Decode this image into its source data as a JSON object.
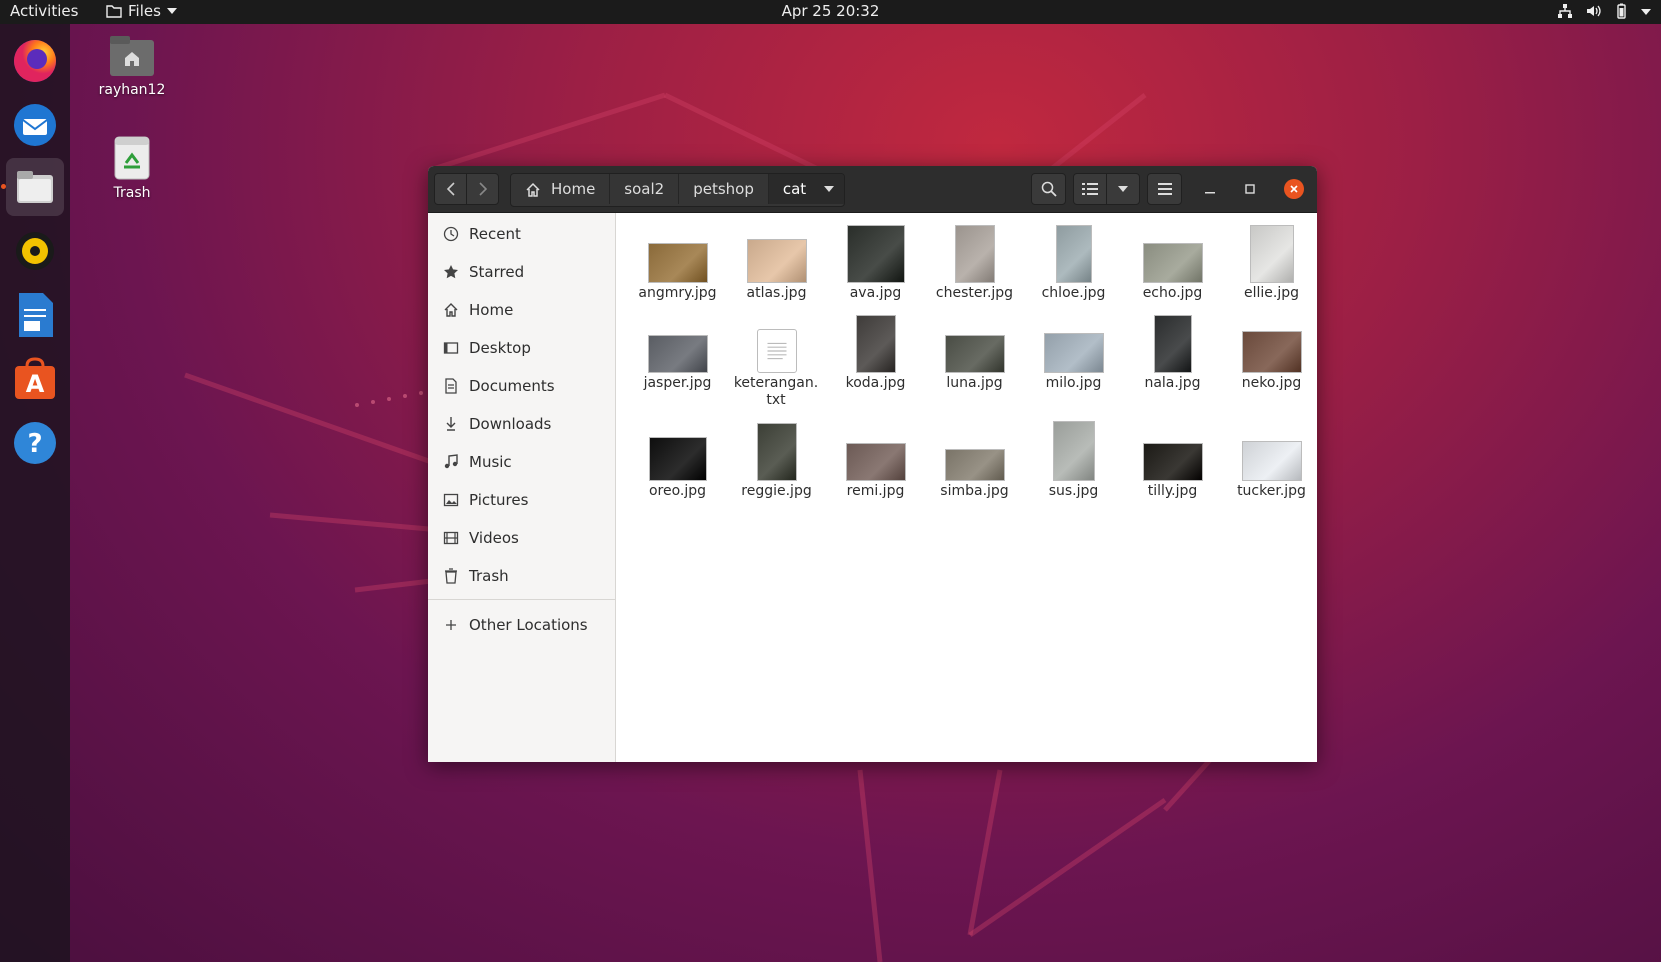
{
  "topbar": {
    "activities": "Activities",
    "app_menu": "Files",
    "clock": "Apr 25  20:32"
  },
  "dock": {
    "apps": [
      "firefox-icon",
      "thunderbird-icon",
      "files-icon",
      "rhythmbox-icon",
      "libreoffice-writer-icon",
      "software-center-icon",
      "help-icon"
    ],
    "active": "files-icon"
  },
  "desktop": {
    "home_label": "rayhan12",
    "trash_label": "Trash"
  },
  "window": {
    "breadcrumbs": [
      "Home",
      "soal2",
      "petshop",
      "cat"
    ],
    "sidebar": {
      "items": [
        "Recent",
        "Starred",
        "Home",
        "Desktop",
        "Documents",
        "Downloads",
        "Music",
        "Pictures",
        "Videos",
        "Trash"
      ],
      "other": "Other Locations"
    },
    "files": [
      {
        "name": "angmry.jpg",
        "color": "#8a6a3a"
      },
      {
        "name": "atlas.jpg",
        "color": "#c9a98c"
      },
      {
        "name": "ava.jpg",
        "color": "#2a2e2a"
      },
      {
        "name": "chester.jpg",
        "color": "#9b948e"
      },
      {
        "name": "chloe.jpg",
        "color": "#8f9ca0"
      },
      {
        "name": "echo.jpg",
        "color": "#8a8d80"
      },
      {
        "name": "ellie.jpg",
        "color": "#c8c8c6"
      },
      {
        "name": "jasper.jpg",
        "color": "#5a5d63"
      },
      {
        "name": "keterangan.txt",
        "color": "#ffffff"
      },
      {
        "name": "koda.jpg",
        "color": "#3f3c3a"
      },
      {
        "name": "luna.jpg",
        "color": "#4a4d45"
      },
      {
        "name": "milo.jpg",
        "color": "#94a0aa"
      },
      {
        "name": "nala.jpg",
        "color": "#2b2d2e"
      },
      {
        "name": "neko.jpg",
        "color": "#6a4a3c"
      },
      {
        "name": "oreo.jpg",
        "color": "#0e0e0e"
      },
      {
        "name": "reggie.jpg",
        "color": "#3c3f36"
      },
      {
        "name": "remi.jpg",
        "color": "#6c5a55"
      },
      {
        "name": "simba.jpg",
        "color": "#7a7468"
      },
      {
        "name": "sus.jpg",
        "color": "#9a9e9a"
      },
      {
        "name": "tilly.jpg",
        "color": "#1c1a16"
      },
      {
        "name": "tucker.jpg",
        "color": "#cfd2d6"
      }
    ]
  }
}
